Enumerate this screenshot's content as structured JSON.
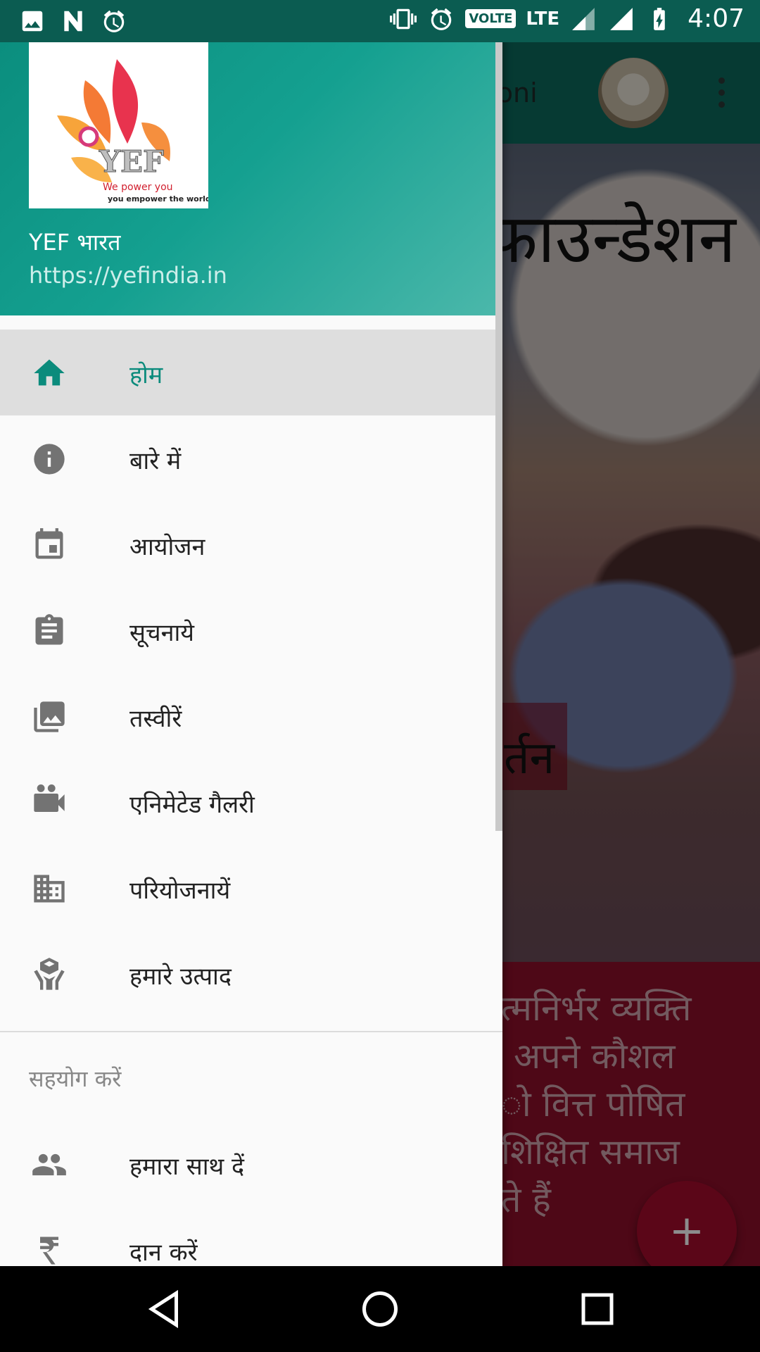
{
  "status_bar": {
    "time": "4:07",
    "volte": "VOLTE",
    "lte": "LTE"
  },
  "app": {
    "toolbar_title": "soni",
    "hero_heading": "फाउन्डेशन",
    "hero_banner_text": "र्तन",
    "red_panel_lines": [
      "त्मनिर्भर व्यक्ति",
      "अपने कौशल",
      "ो वित्त पोषित",
      "शिक्षित समाज",
      "ते हैं"
    ],
    "fab_label": "+"
  },
  "drawer": {
    "title": "YEF भारत",
    "subtitle": "https://yefindia.in",
    "logo_text": "YEF",
    "logo_tagline_1": "We power you",
    "logo_tagline_2": "you empower the world",
    "items": [
      {
        "label": "होम",
        "icon": "home-icon",
        "active": true
      },
      {
        "label": "बारे में",
        "icon": "info-icon"
      },
      {
        "label": "आयोजन",
        "icon": "calendar-icon"
      },
      {
        "label": "सूचनाये",
        "icon": "clipboard-icon"
      },
      {
        "label": "तस्वीरें",
        "icon": "photo-library-icon"
      },
      {
        "label": "एनिमेटेड गैलरी",
        "icon": "video-camera-icon"
      },
      {
        "label": "परियोजनायें",
        "icon": "building-icon"
      },
      {
        "label": "हमारे उत्पाद",
        "icon": "product-hands-icon"
      }
    ],
    "section_header": "सहयोग करें",
    "support_items": [
      {
        "label": "हमारा साथ दें",
        "icon": "people-icon"
      },
      {
        "label": "दान करें",
        "icon": "rupee-icon"
      }
    ]
  },
  "colors": {
    "header_teal": "#14a090",
    "active_teal": "#0b8b7c",
    "fab_red": "#a60c2c"
  }
}
